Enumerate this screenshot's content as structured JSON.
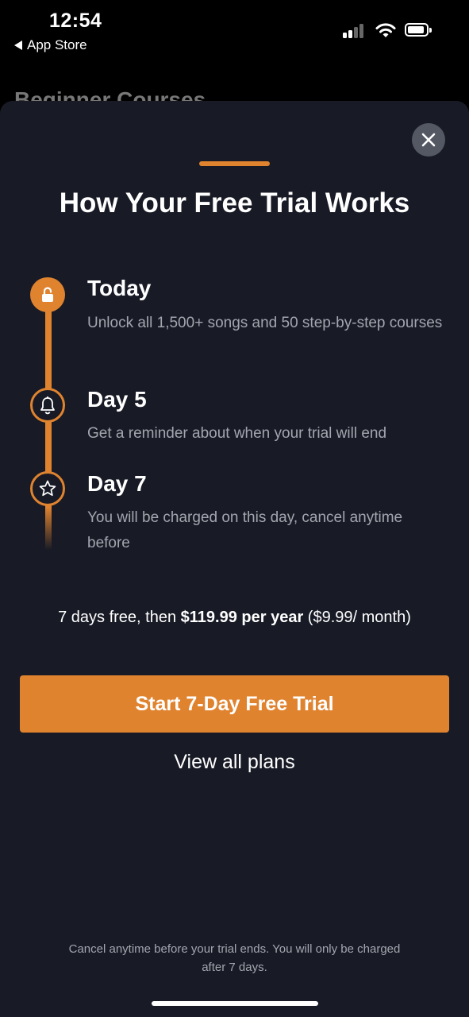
{
  "status_bar": {
    "time": "12:54",
    "back_app_label": "App Store"
  },
  "background": {
    "title": "Beginner Courses"
  },
  "sheet": {
    "title": "How Your Free Trial Works",
    "steps": [
      {
        "icon": "unlock-icon",
        "title": "Today",
        "description": "Unlock all 1,500+ songs and 50 step-by-step courses"
      },
      {
        "icon": "bell-icon",
        "title": "Day 5",
        "description": "Get a reminder about when your trial will end"
      },
      {
        "icon": "star-icon",
        "title": "Day 7",
        "description": "You will be charged on this day, cancel anytime before"
      }
    ],
    "pricing": {
      "prefix": "7 days free, then ",
      "price": "$119.99 per year",
      "suffix": " ($9.99/ month)"
    },
    "cta_label": "Start 7-Day Free Trial",
    "view_plans_label": "View all plans",
    "footer_note": "Cancel anytime before your trial ends. You will only be charged after 7 days."
  },
  "colors": {
    "accent": "#e0832f",
    "sheet_background": "#181b26",
    "secondary_text": "#a3a6ae"
  }
}
